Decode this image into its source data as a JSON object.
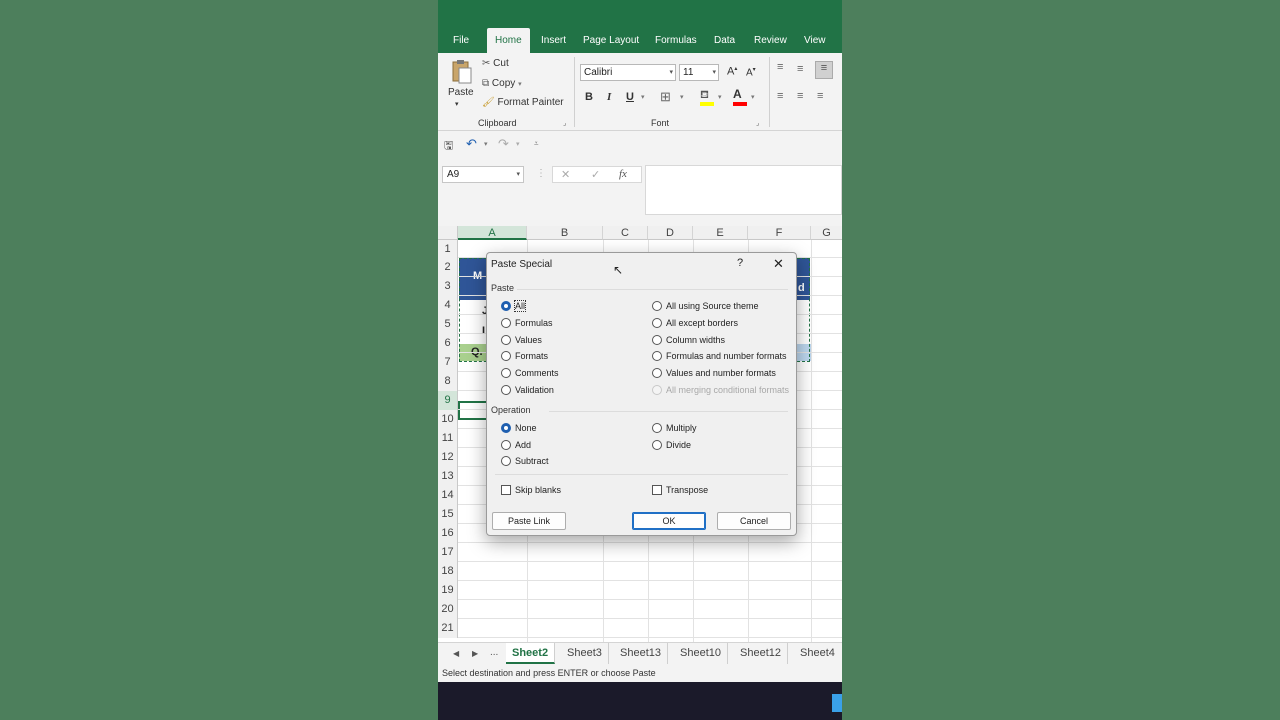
{
  "ribbon_tabs": [
    "File",
    "Home",
    "Insert",
    "Page Layout",
    "Formulas",
    "Data",
    "Review",
    "View"
  ],
  "clipboard": {
    "paste": "Paste",
    "cut": "Cut",
    "copy": "Copy",
    "format_painter": "Format Painter",
    "group_label": "Clipboard"
  },
  "font": {
    "name": "Calibri",
    "size": "11",
    "bold": "B",
    "italic": "I",
    "underline": "U",
    "grow": "A",
    "shrink": "A",
    "group_label": "Font",
    "fill_color": "#ffff00",
    "font_color": "#ff0000"
  },
  "formula_bar": {
    "name_box": "A9",
    "fx": "fx",
    "content": ""
  },
  "grid": {
    "columns": [
      "A",
      "B",
      "C",
      "D",
      "E",
      "F",
      "G"
    ],
    "rows": [
      "1",
      "2",
      "3",
      "4",
      "5",
      "6",
      "7",
      "8",
      "9",
      "10",
      "11",
      "12",
      "13",
      "14",
      "15",
      "16",
      "17",
      "18",
      "19",
      "20",
      "21"
    ],
    "selected_column": "A",
    "selected_row": "9",
    "visible_cell_fragments": {
      "a2": "M",
      "a4": "J",
      "a5": "I",
      "a6": "Q.",
      "f3": "d"
    }
  },
  "sheet_tabs": [
    "Sheet2",
    "Sheet3",
    "Sheet13",
    "Sheet10",
    "Sheet12",
    "Sheet4"
  ],
  "active_sheet": "Sheet2",
  "sheet_nav_more": "...",
  "status_text": "Select destination and press ENTER or choose Paste",
  "dialog": {
    "title": "Paste Special",
    "help": "?",
    "close": "✕",
    "paste_section": "Paste",
    "paste_left": [
      "All",
      "Formulas",
      "Values",
      "Formats",
      "Comments",
      "Validation"
    ],
    "paste_right": [
      "All using Source theme",
      "All except borders",
      "Column widths",
      "Formulas and number formats",
      "Values and number formats",
      "All merging conditional formats"
    ],
    "paste_selected": "All",
    "paste_disabled": "All merging conditional formats",
    "operation_section": "Operation",
    "operation_left": [
      "None",
      "Add",
      "Subtract"
    ],
    "operation_right": [
      "Multiply",
      "Divide"
    ],
    "operation_selected": "None",
    "skip_blanks": "Skip blanks",
    "transpose": "Transpose",
    "paste_link": "Paste Link",
    "ok": "OK",
    "cancel": "Cancel"
  },
  "colors": {
    "excel_green": "#217346",
    "background": "#4d7f5c",
    "header_blue": "#2f5597",
    "cell_green": "#a9d08e"
  }
}
